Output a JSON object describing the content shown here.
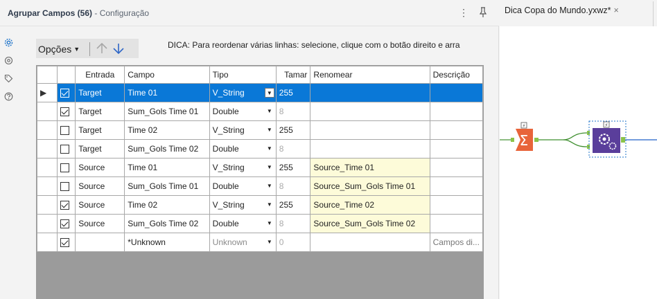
{
  "panel": {
    "title": "Agrupar Campos (56)",
    "subtitle": "- Configuração"
  },
  "header_icons": {
    "menu": "⋮",
    "pin": "pin-icon"
  },
  "rail_icons": [
    "settings-icon",
    "search-target-icon",
    "tag-icon",
    "help-icon"
  ],
  "toolbar": {
    "options_label": "Opções",
    "move_up": "arrow-up-icon",
    "move_down": "arrow-down-icon"
  },
  "tip": "DICA: Para reordenar várias linhas: selecione, clique com o botão direito e arra",
  "grid": {
    "headers": [
      "Entrada",
      "Campo",
      "Tipo",
      "Tamar",
      "Renomear",
      "Descrição"
    ],
    "rows": [
      {
        "checked": true,
        "entrada": "Target",
        "campo": "Time 01",
        "tipo": "V_String",
        "tamanho": "255",
        "renomear": "",
        "descricao": ""
      },
      {
        "checked": true,
        "entrada": "Target",
        "campo": "Sum_Gols Time 01",
        "tipo": "Double",
        "tamanho": "8",
        "renomear": "",
        "descricao": ""
      },
      {
        "checked": false,
        "entrada": "Target",
        "campo": "Time 02",
        "tipo": "V_String",
        "tamanho": "255",
        "renomear": "",
        "descricao": ""
      },
      {
        "checked": false,
        "entrada": "Target",
        "campo": "Sum_Gols Time 02",
        "tipo": "Double",
        "tamanho": "8",
        "renomear": "",
        "descricao": ""
      },
      {
        "checked": false,
        "entrada": "Source",
        "campo": "Time 01",
        "tipo": "V_String",
        "tamanho": "255",
        "renomear": "Source_Time 01",
        "descricao": ""
      },
      {
        "checked": false,
        "entrada": "Source",
        "campo": "Sum_Gols Time 01",
        "tipo": "Double",
        "tamanho": "8",
        "renomear": "Source_Sum_Gols Time 01",
        "descricao": ""
      },
      {
        "checked": true,
        "entrada": "Source",
        "campo": "Time 02",
        "tipo": "V_String",
        "tamanho": "255",
        "renomear": "Source_Time 02",
        "descricao": ""
      },
      {
        "checked": true,
        "entrada": "Source",
        "campo": "Sum_Gols Time 02",
        "tipo": "Double",
        "tamanho": "8",
        "renomear": "Source_Sum_Gols Time 02",
        "descricao": ""
      },
      {
        "checked": true,
        "entrada": "",
        "campo": "*Unknown",
        "tipo": "Unknown",
        "tamanho": "0",
        "renomear": "",
        "descricao": "Campos di..."
      }
    ]
  },
  "canvas": {
    "tab_label": "Dica Copa do Mundo.yxwz*",
    "tab_close": "×",
    "tools": [
      "summarize-tool-icon",
      "macro-tool-icon"
    ]
  },
  "colors": {
    "selection": "#0a78d7",
    "rename_bg": "#fdfbd9",
    "summarize": "#e8643a",
    "macro": "#5a3e9b",
    "connector": "#3f8f2f"
  }
}
